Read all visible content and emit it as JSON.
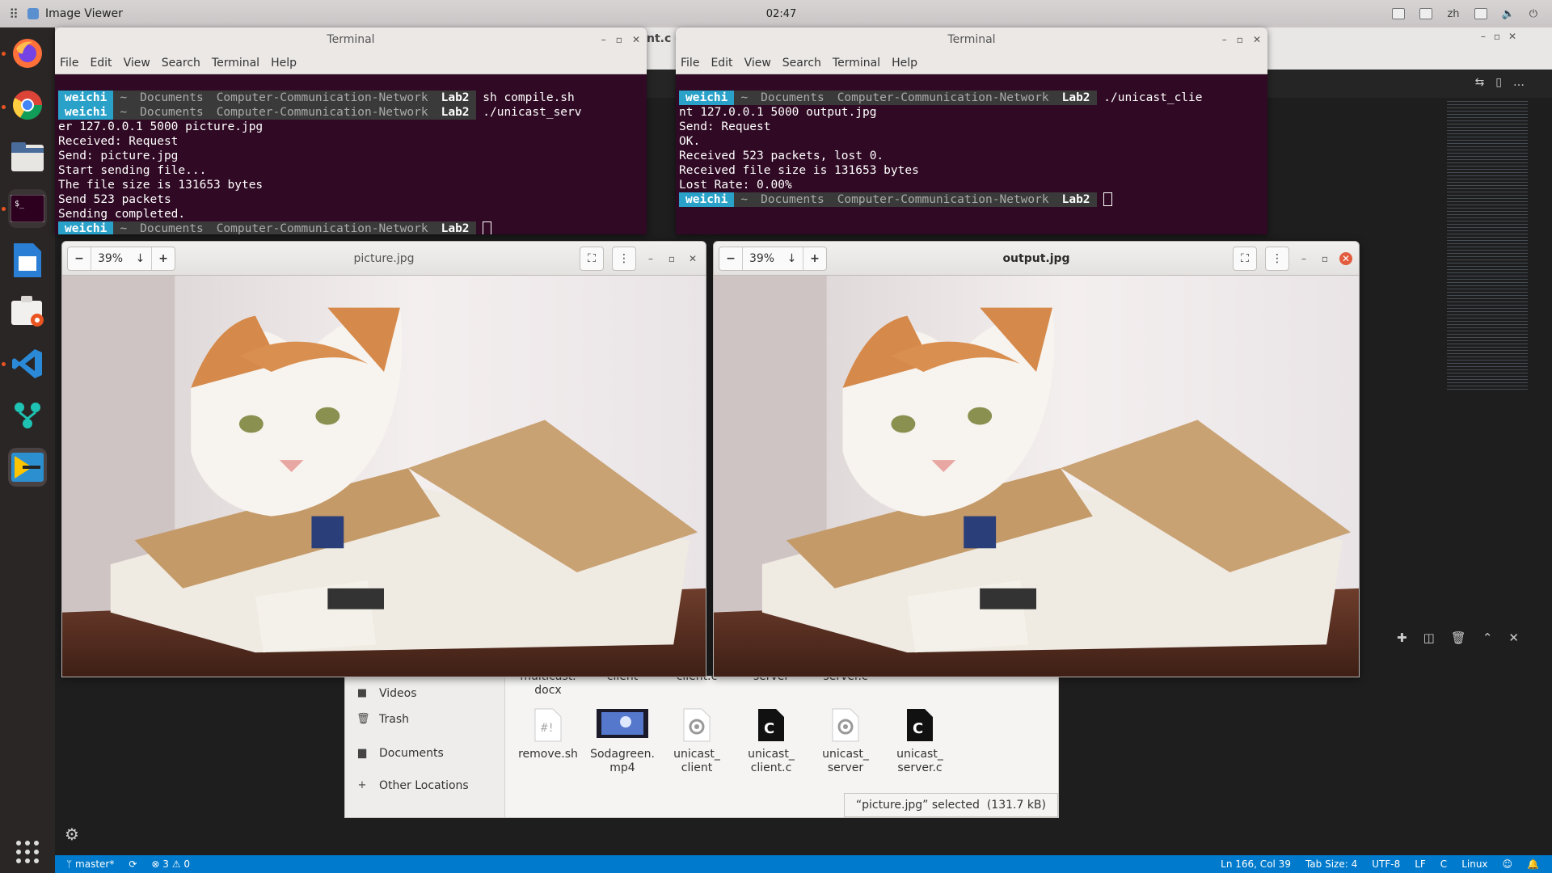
{
  "topbar": {
    "app_name": "Image Viewer",
    "clock": "      02:47",
    "input_method": "zh"
  },
  "terminal_left": {
    "title": "Terminal",
    "menu": [
      "File",
      "Edit",
      "View",
      "Search",
      "Terminal",
      "Help"
    ],
    "prompt": {
      "user": "weichi",
      "home": "~",
      "path1": "Documents",
      "path2": "Computer-Communication-Network",
      "path3": "Lab2"
    },
    "cmd1": "sh compile.sh",
    "cmd2": "./unicast_serv",
    "lines": [
      "er 127.0.0.1 5000 picture.jpg",
      "Received: Request",
      "Send: picture.jpg",
      "Start sending file...",
      "The file size is 131653 bytes",
      "Send 523 packets",
      "Sending completed."
    ]
  },
  "terminal_right": {
    "title": "Terminal",
    "menu": [
      "File",
      "Edit",
      "View",
      "Search",
      "Terminal",
      "Help"
    ],
    "cmd1": "./unicast_clie",
    "lines": [
      "nt 127.0.0.1 5000 output.jpg",
      "Send: Request",
      "OK.",
      "Received 523 packets, lost 0.",
      "Received file size is 131653 bytes",
      "Lost Rate: 0.00%"
    ]
  },
  "viewer_left": {
    "zoom": "39%",
    "title": "picture.jpg"
  },
  "viewer_right": {
    "zoom": "39%",
    "title": "output.jpg"
  },
  "files": {
    "sidebar": [
      "Videos",
      "Trash",
      "Documents",
      "Other Locations"
    ],
    "partial_row": [
      "multicast.\ndocx",
      "client",
      "client.c",
      "server",
      "server.c"
    ],
    "items": [
      {
        "name": "remove.sh",
        "kind": "script"
      },
      {
        "name": "Sodagreen.\nmp4",
        "kind": "video"
      },
      {
        "name": "unicast_\nclient",
        "kind": "exec"
      },
      {
        "name": "unicast_\nclient.c",
        "kind": "c"
      },
      {
        "name": "unicast_\nserver",
        "kind": "exec"
      },
      {
        "name": "unicast_\nserver.c",
        "kind": "c"
      }
    ],
    "status": "“picture.jpg” selected  (131.7 kB)"
  },
  "statusbar": {
    "branch": "master*",
    "errors": "3",
    "warnings": "0",
    "position": "Ln 166, Col 39",
    "tab_size": "Tab Size: 4",
    "encoding": "UTF-8",
    "eol": "LF",
    "language": "C",
    "os": "Linux"
  },
  "vscode_tab_fragment": "nt.c -",
  "colors": {
    "terminal_bg": "#300a24",
    "prompt_user": "#2aa1c8",
    "statusbar": "#007acc",
    "dock": "#2b2626"
  }
}
